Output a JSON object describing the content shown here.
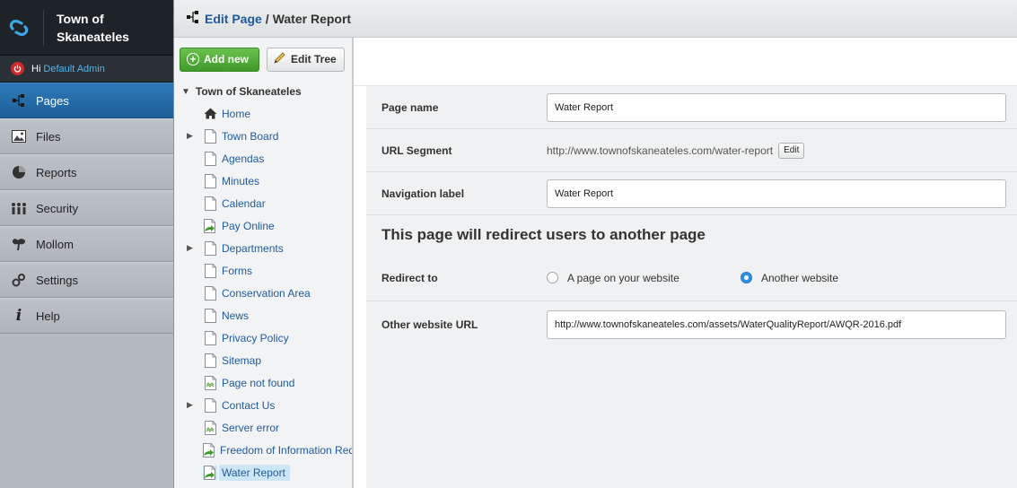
{
  "brand": {
    "title_line1": "Town of",
    "title_line2": "Skaneateles"
  },
  "user": {
    "greeting": "Hi",
    "name": "Default Admin"
  },
  "menu": {
    "items": [
      {
        "label": "Pages",
        "icon": "sitetree-icon",
        "active": true
      },
      {
        "label": "Files",
        "icon": "image-icon"
      },
      {
        "label": "Reports",
        "icon": "pie-chart-icon"
      },
      {
        "label": "Security",
        "icon": "users-icon"
      },
      {
        "label": "Mollom",
        "icon": "mollom-icon"
      },
      {
        "label": "Settings",
        "icon": "gear-icon"
      },
      {
        "label": "Help",
        "icon": "info-icon"
      }
    ]
  },
  "header": {
    "link": "Edit Page",
    "separator": "/",
    "current": "Water Report"
  },
  "toolbar": {
    "add_label": "Add new",
    "edit_tree_label": "Edit Tree"
  },
  "tree": {
    "root": "Town of Skaneateles",
    "items": [
      {
        "label": "Home",
        "icon": "home-icon",
        "expandable": false
      },
      {
        "label": "Town Board",
        "icon": "page-icon",
        "expandable": true
      },
      {
        "label": "Agendas",
        "icon": "page-icon",
        "expandable": false
      },
      {
        "label": "Minutes",
        "icon": "page-icon",
        "expandable": false
      },
      {
        "label": "Calendar",
        "icon": "page-icon",
        "expandable": false
      },
      {
        "label": "Pay Online",
        "icon": "redirect-page-icon",
        "expandable": false
      },
      {
        "label": "Departments",
        "icon": "page-icon",
        "expandable": true
      },
      {
        "label": "Forms",
        "icon": "page-icon",
        "expandable": false
      },
      {
        "label": "Conservation Area",
        "icon": "page-icon",
        "expandable": false
      },
      {
        "label": "News",
        "icon": "page-icon",
        "expandable": false
      },
      {
        "label": "Privacy Policy",
        "icon": "page-icon",
        "expandable": false
      },
      {
        "label": "Sitemap",
        "icon": "page-icon",
        "expandable": false
      },
      {
        "label": "Page not found",
        "icon": "error-page-icon",
        "expandable": false
      },
      {
        "label": "Contact Us",
        "icon": "page-icon",
        "expandable": true
      },
      {
        "label": "Server error",
        "icon": "error-page-icon",
        "expandable": false
      },
      {
        "label": "Freedom of Information Req",
        "icon": "redirect-page-icon",
        "expandable": false
      },
      {
        "label": "Water Report",
        "icon": "redirect-page-icon",
        "expandable": false,
        "selected": true
      }
    ]
  },
  "form": {
    "page_name": {
      "label": "Page name",
      "value": "Water Report"
    },
    "url_segment": {
      "label": "URL Segment",
      "value": "http://www.townofskaneateles.com/water-report",
      "edit_label": "Edit"
    },
    "nav_label": {
      "label": "Navigation label",
      "value": "Water Report"
    },
    "section_heading": "This page will redirect users to another page",
    "redirect": {
      "label": "Redirect to",
      "option_internal": "A page on your website",
      "option_external": "Another website",
      "selected": "external"
    },
    "external_url": {
      "label": "Other website URL",
      "value": "http://www.townofskaneateles.com/assets/WaterQualityReport/AWQR-2016.pdf"
    }
  },
  "colors": {
    "accent": "#2e7ab8",
    "link": "#1f5a9c",
    "add_button": "#4fae35"
  }
}
